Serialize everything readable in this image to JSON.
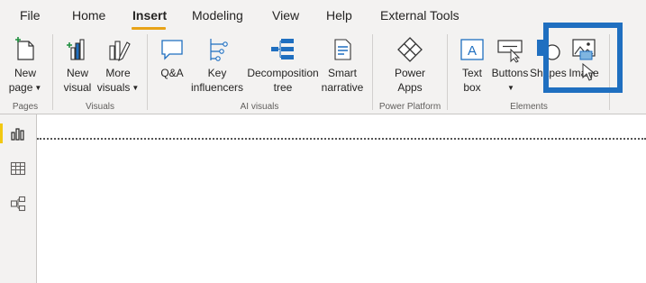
{
  "tabs": [
    {
      "label": "File"
    },
    {
      "label": "Home"
    },
    {
      "label": "Insert",
      "active": true
    },
    {
      "label": "Modeling"
    },
    {
      "label": "View"
    },
    {
      "label": "Help"
    },
    {
      "label": "External Tools"
    }
  ],
  "ribbon": {
    "pages": {
      "new_page": [
        "New",
        "page"
      ],
      "group": "Pages"
    },
    "visuals": {
      "new_visual": [
        "New",
        "visual"
      ],
      "more_visuals": [
        "More",
        "visuals"
      ],
      "group": "Visuals"
    },
    "ai_visuals": {
      "qa": [
        "Q&A"
      ],
      "key_influencers": [
        "Key",
        "influencers"
      ],
      "decomposition_tree": [
        "Decomposition",
        "tree"
      ],
      "smart_narrative": [
        "Smart",
        "narrative"
      ],
      "group": "AI visuals"
    },
    "power_platform": {
      "power_apps": [
        "Power",
        "Apps"
      ],
      "group": "Power Platform"
    },
    "elements": {
      "text_box": [
        "Text",
        "box"
      ],
      "buttons": [
        "Buttons"
      ],
      "shapes": [
        "Shapes"
      ],
      "image": [
        "Image"
      ],
      "group": "Elements"
    }
  },
  "colors": {
    "accent_underline": "#e8a317",
    "highlight_box": "#1f6fc0",
    "icon_blue": "#1f6fc0",
    "active_nav_bar": "#f2c811"
  },
  "left_nav": {
    "icons": [
      "report-view-icon",
      "data-view-icon",
      "model-view-icon"
    ]
  }
}
